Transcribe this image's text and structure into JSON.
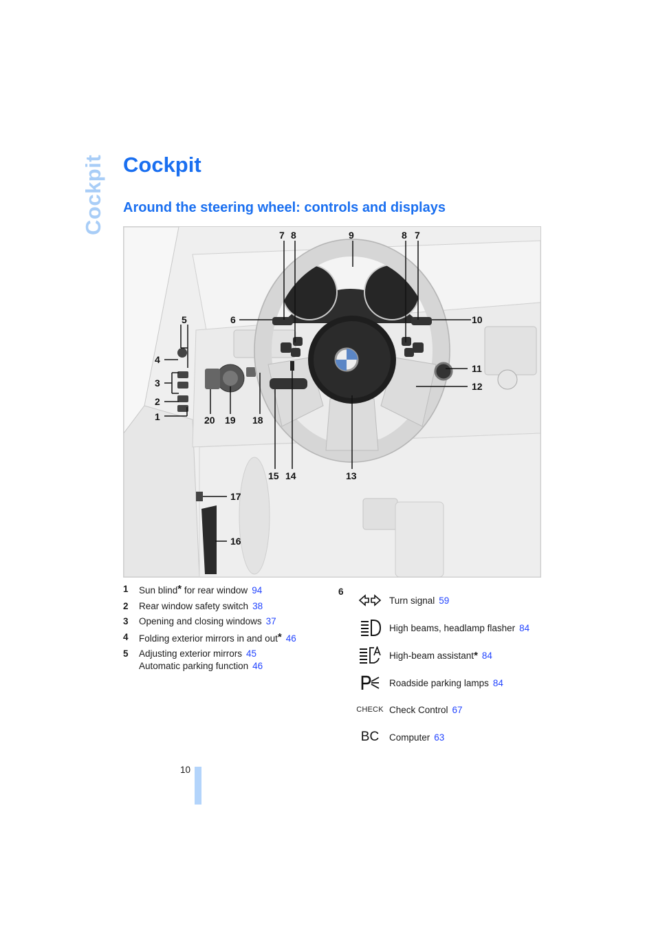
{
  "side_tab": "Cockpit",
  "page_title": "Cockpit",
  "section_title": "Around the steering wheel: controls and displays",
  "colors": {
    "accent": "#1a6ff0",
    "side_tab": "#a8cdf7",
    "link": "#2244ff",
    "page_bar": "#b3d4fb"
  },
  "illustration": {
    "description": "Steering wheel and cockpit line drawing",
    "callouts": [
      "7",
      "8",
      "9",
      "8",
      "7",
      "6",
      "10",
      "5",
      "4",
      "3",
      "2",
      "1",
      "11",
      "12",
      "20",
      "19",
      "18",
      "15",
      "14",
      "13",
      "17",
      "16"
    ]
  },
  "left_items": [
    {
      "num": "1",
      "text": "Sun blind",
      "star": true,
      "suffix": " for rear window",
      "page": "94"
    },
    {
      "num": "2",
      "text": "Rear window safety switch",
      "star": false,
      "suffix": "",
      "page": "38"
    },
    {
      "num": "3",
      "text": "Opening and closing windows",
      "star": false,
      "suffix": "",
      "page": "37"
    },
    {
      "num": "4",
      "text": "Folding exterior mirrors in and out",
      "star": true,
      "suffix": "",
      "page": "46"
    },
    {
      "num": "5",
      "text": "Adjusting exterior mirrors",
      "star": false,
      "suffix": "",
      "page": "45"
    },
    {
      "num": "",
      "text": "Automatic parking function",
      "star": false,
      "suffix": "",
      "page": "46"
    }
  ],
  "right_group": {
    "num": "6",
    "items": [
      {
        "icon": "turn-signal-icon",
        "text": "Turn signal",
        "star": false,
        "page": "59"
      },
      {
        "icon": "high-beam-icon",
        "text": "High beams, headlamp flasher",
        "star": false,
        "page": "84"
      },
      {
        "icon": "high-beam-assistant-icon",
        "text": "High-beam assistant",
        "star": true,
        "page": "84"
      },
      {
        "icon": "parking-lamps-icon",
        "text": "Roadside parking lamps",
        "star": false,
        "page": "84"
      },
      {
        "icon": "check-control-icon",
        "glyph": "CHECK",
        "text": "Check Control",
        "star": false,
        "page": "67"
      },
      {
        "icon": "computer-icon",
        "glyph": "BC",
        "text": "Computer",
        "star": false,
        "page": "63"
      }
    ]
  },
  "star_glyph": "*",
  "page_number": "10"
}
